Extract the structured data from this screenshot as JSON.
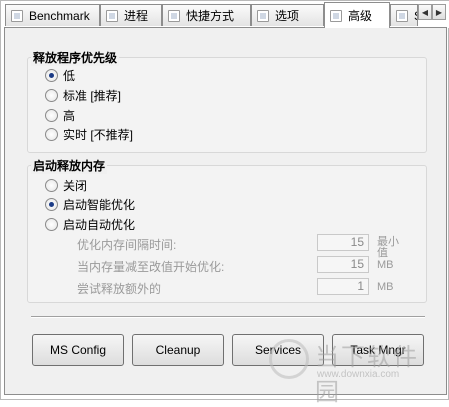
{
  "tabs": [
    {
      "label": "Benchmark",
      "active": false
    },
    {
      "label": "进程",
      "active": false
    },
    {
      "label": "快捷方式",
      "active": false
    },
    {
      "label": "选项",
      "active": false
    },
    {
      "label": "高级",
      "active": true
    },
    {
      "label": "S",
      "active": false
    }
  ],
  "tab_scroll": {
    "left": "◀",
    "right": "▶"
  },
  "priority_group": {
    "title": "释放程序优先级",
    "options": [
      {
        "label": "低",
        "checked": true
      },
      {
        "label": "标准 [推荐]",
        "checked": false
      },
      {
        "label": "高",
        "checked": false
      },
      {
        "label": "实时 [不推荐]",
        "checked": false
      }
    ]
  },
  "memory_group": {
    "title": "启动释放内存",
    "options": [
      {
        "label": "关闭",
        "checked": false
      },
      {
        "label": "启动智能优化",
        "checked": true
      },
      {
        "label": "启动自动优化",
        "checked": false
      }
    ],
    "settings": [
      {
        "label": "优化内存间隔时间:",
        "value": "15",
        "unit": "最小值"
      },
      {
        "label": "当内存量减至改值开始优化:",
        "value": "15",
        "unit": "MB"
      },
      {
        "label": "尝试释放额外的",
        "value": "1",
        "unit": "MB"
      }
    ]
  },
  "buttons": {
    "ms_config": "MS Config",
    "cleanup": "Cleanup",
    "services": "Services",
    "task_mngr": "Task Mngr"
  },
  "watermark": {
    "text": "当下软件园",
    "url": "www.downxia.com"
  }
}
